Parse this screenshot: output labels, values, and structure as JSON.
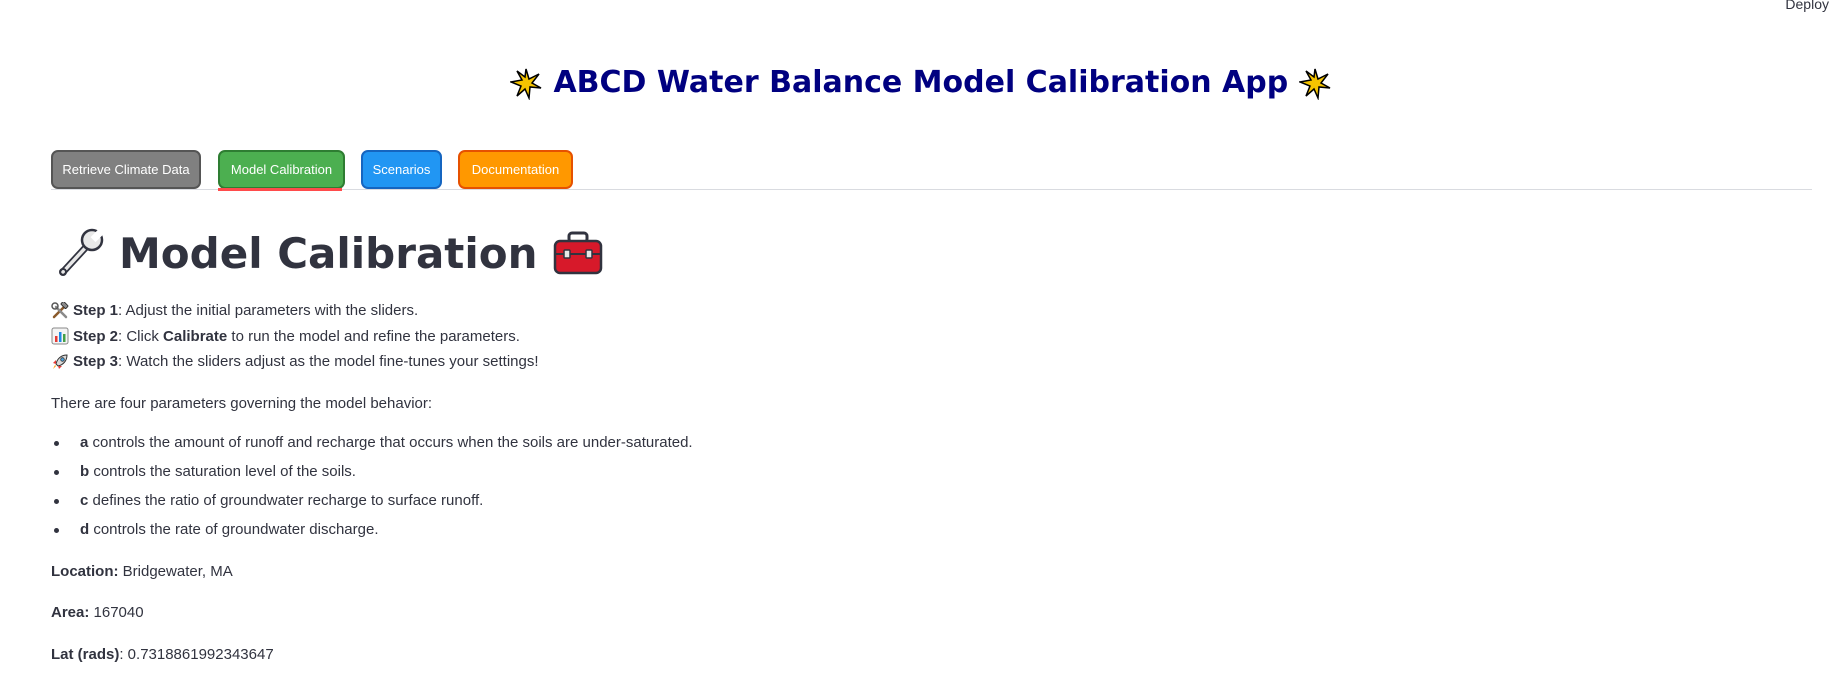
{
  "header": {
    "deploy_label": "Deploy"
  },
  "app": {
    "title": "ABCD Water Balance Model Calibration App",
    "title_color": "#000080",
    "star_icon": "glowing-star-icon"
  },
  "tabs": [
    {
      "label": "Retrieve Climate Data",
      "color": "#808080"
    },
    {
      "label": "Model Calibration",
      "color": "#4caf50",
      "selected": true
    },
    {
      "label": "Scenarios",
      "color": "#2196f3"
    },
    {
      "label": "Documentation",
      "color": "#ff9800"
    }
  ],
  "page": {
    "heading": "Model Calibration",
    "heading_icons": [
      "wrench-icon",
      "toolbox-icon"
    ]
  },
  "steps": [
    {
      "icon": "hammer-and-wrench-icon",
      "label": "Step 1",
      "pre": ": Adjust the initial parameters with the sliders.",
      "bold": "",
      "post": ""
    },
    {
      "icon": "bar-chart-icon",
      "label": "Step 2",
      "pre": ": Click ",
      "bold": "Calibrate",
      "post": " to run the model and refine the parameters."
    },
    {
      "icon": "rocket-icon",
      "label": "Step 3",
      "pre": ": Watch the sliders adjust as the model fine-tunes your settings!",
      "bold": "",
      "post": ""
    }
  ],
  "intro": "There are four parameters governing the model behavior:",
  "parameters": [
    {
      "name": "a",
      "desc": " controls the amount of runoff and recharge that occurs when the soils are under-saturated."
    },
    {
      "name": "b",
      "desc": " controls the saturation level of the soils."
    },
    {
      "name": "c",
      "desc": " defines the ratio of groundwater recharge to surface runoff."
    },
    {
      "name": "d",
      "desc": " controls the rate of groundwater discharge."
    }
  ],
  "info": {
    "location_label": "Location:",
    "location_value": " Bridgewater, MA",
    "area_label": "Area:",
    "area_value": " 167040",
    "lat_label": "Lat (rads)",
    "lat_value": ": 0.7318861992343647"
  }
}
